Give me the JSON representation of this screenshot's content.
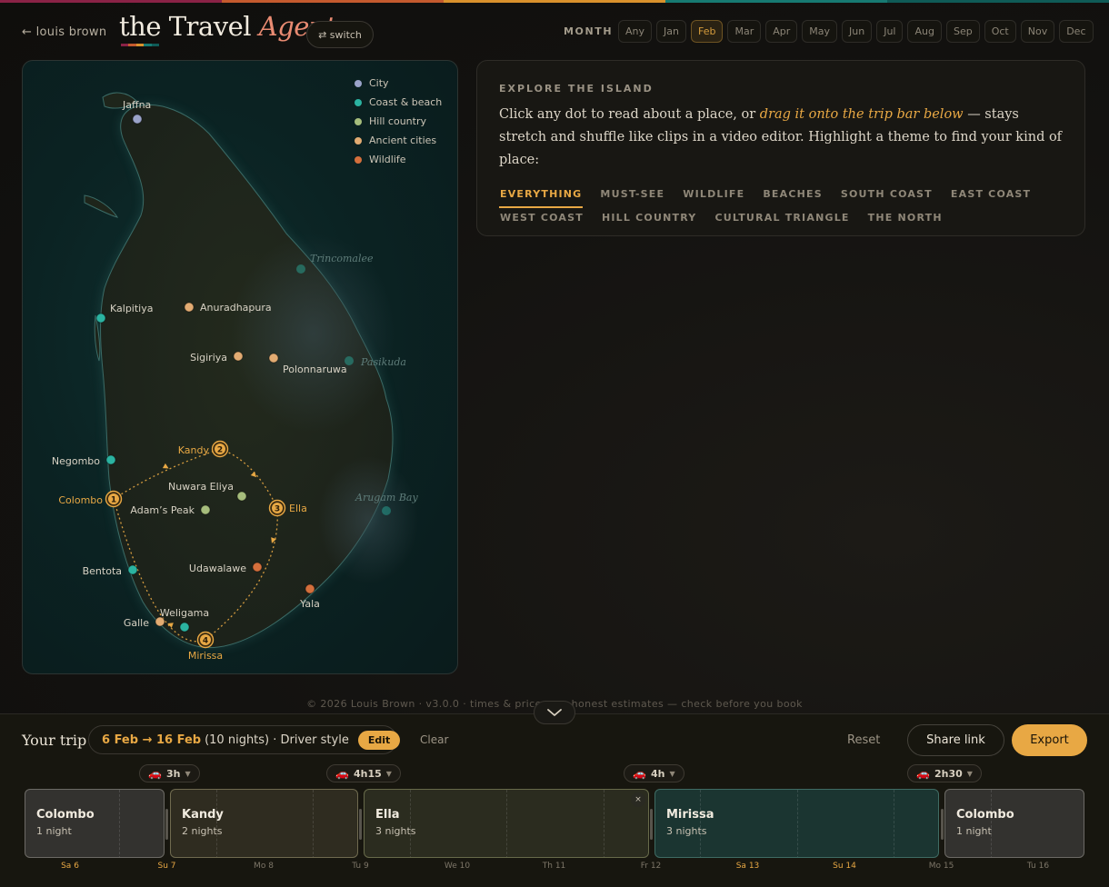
{
  "colors": {
    "accent": "#e8a844",
    "brand_italic": "#e98b72",
    "stripe": [
      "#8a2246",
      "#c45a2e",
      "#d9912c",
      "#177a72",
      "#0f5b57"
    ],
    "city": "#9aa3c9",
    "coast": "#2bb3a1",
    "hill": "#a6bd7c",
    "ancient": "#e2ab72",
    "wildlife": "#d46f3c"
  },
  "header": {
    "back_link": "← louis brown",
    "brand_main": "the Travel",
    "brand_italic": "Agent",
    "switch_label": "⇄ switch",
    "month_label": "MONTH",
    "months": [
      "Any",
      "Jan",
      "Feb",
      "Mar",
      "Apr",
      "May",
      "Jun",
      "Jul",
      "Aug",
      "Sep",
      "Oct",
      "Nov",
      "Dec"
    ],
    "selected_month": "Feb"
  },
  "legend": [
    {
      "label": "City",
      "icon": "dot",
      "color": "#9aa3c9"
    },
    {
      "label": "Coast & beach",
      "icon": "dot",
      "color": "#2bb3a1"
    },
    {
      "label": "Hill country",
      "icon": "dot",
      "color": "#a6bd7c"
    },
    {
      "label": "Ancient cities",
      "icon": "dot",
      "color": "#e2ab72"
    },
    {
      "label": "Wildlife",
      "icon": "dot",
      "color": "#d46f3c"
    }
  ],
  "map": {
    "places": [
      {
        "name": "Jaffna",
        "type": "city"
      },
      {
        "name": "Trincomalee",
        "type": "coast",
        "dimmed": true
      },
      {
        "name": "Kalpitiya",
        "type": "coast"
      },
      {
        "name": "Anuradhapura",
        "type": "ancient"
      },
      {
        "name": "Sigiriya",
        "type": "ancient"
      },
      {
        "name": "Polonnaruwa",
        "type": "ancient"
      },
      {
        "name": "Pasikuda",
        "type": "coast",
        "dimmed": true
      },
      {
        "name": "Negombo",
        "type": "coast"
      },
      {
        "name": "Kandy",
        "type": "route",
        "stop": "2"
      },
      {
        "name": "Nuwara Eliya",
        "type": "hill"
      },
      {
        "name": "Colombo",
        "type": "route",
        "stop": "1"
      },
      {
        "name": "Adam’s Peak",
        "type": "hill"
      },
      {
        "name": "Ella",
        "type": "route",
        "stop": "3"
      },
      {
        "name": "Arugam Bay",
        "type": "coast",
        "dimmed": true
      },
      {
        "name": "Bentota",
        "type": "coast"
      },
      {
        "name": "Udawalawe",
        "type": "wildlife"
      },
      {
        "name": "Yala",
        "type": "wildlife"
      },
      {
        "name": "Weligama",
        "type": "coast"
      },
      {
        "name": "Galle",
        "type": "ancient"
      },
      {
        "name": "Mirissa",
        "type": "route",
        "stop": "4"
      }
    ]
  },
  "explore": {
    "title": "EXPLORE THE ISLAND",
    "text_before": "Click any dot to read about a place, or ",
    "text_em": "drag it onto the trip bar below",
    "text_after": " — stays stretch and shuffle like clips in a video editor. Highlight a theme to find your kind of place:",
    "filters": [
      "EVERYTHING",
      "MUST-SEE",
      "WILDLIFE",
      "BEACHES",
      "SOUTH COAST",
      "EAST COAST",
      "WEST COAST",
      "HILL COUNTRY",
      "CULTURAL TRIANGLE",
      "THE NORTH"
    ],
    "active_filter": "EVERYTHING"
  },
  "footer": {
    "text": "© 2026 Louis Brown  ·  v3.0.0  ·  times & prices are honest estimates — check before you book"
  },
  "trip": {
    "title": "Your trip",
    "dates": "6 Feb → 16 Feb",
    "summary": "(10 nights) · Driver style",
    "edit_label": "Edit",
    "clear_label": "Clear",
    "reset_label": "Reset",
    "share_label": "Share link",
    "export_label": "Export",
    "drives": [
      "3h",
      "4h15",
      "4h",
      "2h30"
    ],
    "stays": [
      {
        "name": "Colombo",
        "nights": "1 night",
        "kind": "city"
      },
      {
        "name": "Kandy",
        "nights": "2 nights",
        "kind": "culture"
      },
      {
        "name": "Ella",
        "nights": "3 nights",
        "kind": "hill"
      },
      {
        "name": "Mirissa",
        "nights": "3 nights",
        "kind": "coast"
      },
      {
        "name": "Colombo",
        "nights": "1 night",
        "kind": "city"
      }
    ],
    "days": [
      {
        "dow": "Sa",
        "day": "6",
        "weekend": true
      },
      {
        "dow": "Su",
        "day": "7",
        "weekend": true
      },
      {
        "dow": "Mo",
        "day": "8",
        "weekend": false
      },
      {
        "dow": "Tu",
        "day": "9",
        "weekend": false
      },
      {
        "dow": "We",
        "day": "10",
        "weekend": false
      },
      {
        "dow": "Th",
        "day": "11",
        "weekend": false
      },
      {
        "dow": "Fr",
        "day": "12",
        "weekend": false
      },
      {
        "dow": "Sa",
        "day": "13",
        "weekend": true
      },
      {
        "dow": "Su",
        "day": "14",
        "weekend": true
      },
      {
        "dow": "Mo",
        "day": "15",
        "weekend": false
      },
      {
        "dow": "Tu",
        "day": "16",
        "weekend": false
      }
    ]
  }
}
